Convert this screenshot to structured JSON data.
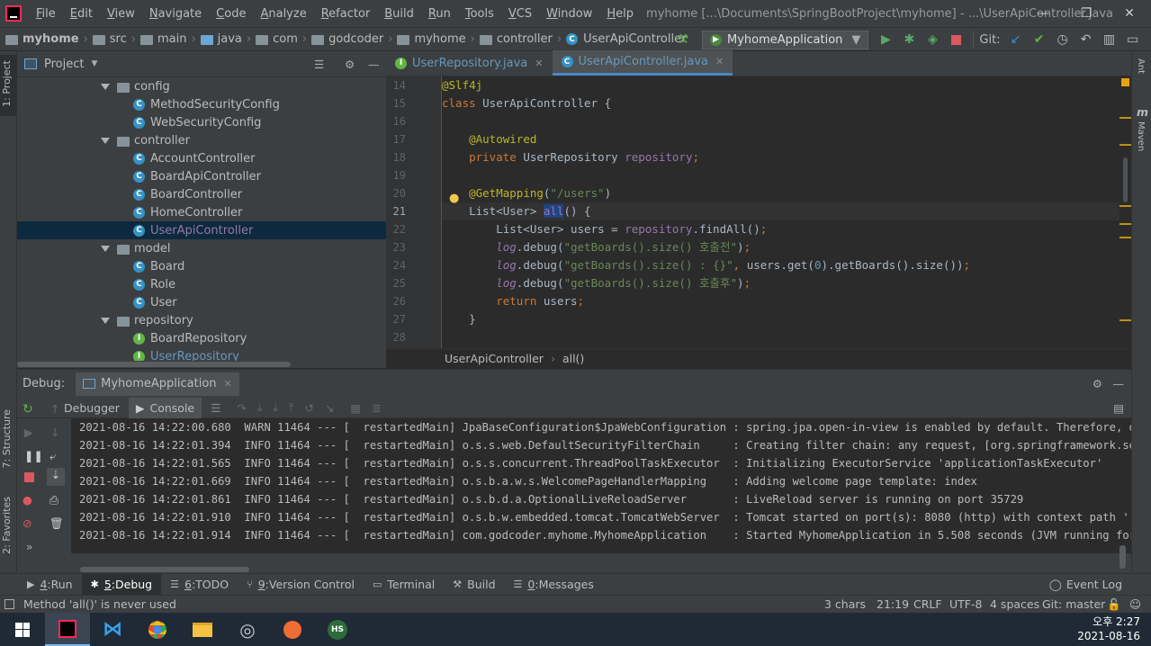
{
  "window": {
    "title": "myhome [...\\Documents\\SpringBootProject\\myhome] - ...\\UserApiController.java",
    "menu": [
      "File",
      "Edit",
      "View",
      "Navigate",
      "Code",
      "Analyze",
      "Refactor",
      "Build",
      "Run",
      "Tools",
      "VCS",
      "Window",
      "Help"
    ]
  },
  "breadcrumb": [
    "myhome",
    "src",
    "main",
    "java",
    "com",
    "godcoder",
    "myhome",
    "controller",
    "UserApiController"
  ],
  "toolbar": {
    "run_config": "MyhomeApplication",
    "git_label": "Git:"
  },
  "project_panel": {
    "title": "Project",
    "tree": [
      {
        "label": "config",
        "type": "folder",
        "indent": 0
      },
      {
        "label": "MethodSecurityConfig",
        "type": "class",
        "indent": 1
      },
      {
        "label": "WebSecurityConfig",
        "type": "class",
        "indent": 1
      },
      {
        "label": "controller",
        "type": "folder",
        "indent": 0
      },
      {
        "label": "AccountController",
        "type": "class",
        "indent": 1
      },
      {
        "label": "BoardApiController",
        "type": "class",
        "indent": 1
      },
      {
        "label": "BoardController",
        "type": "class",
        "indent": 1
      },
      {
        "label": "HomeController",
        "type": "class",
        "indent": 1
      },
      {
        "label": "UserApiController",
        "type": "class",
        "indent": 1,
        "selected": true
      },
      {
        "label": "model",
        "type": "folder",
        "indent": 0
      },
      {
        "label": "Board",
        "type": "class",
        "indent": 1
      },
      {
        "label": "Role",
        "type": "class",
        "indent": 1
      },
      {
        "label": "User",
        "type": "class",
        "indent": 1
      },
      {
        "label": "repository",
        "type": "folder",
        "indent": 0
      },
      {
        "label": "BoardRepository",
        "type": "interface",
        "indent": 1
      },
      {
        "label": "UserRepository",
        "type": "interface",
        "indent": 1
      }
    ]
  },
  "editor": {
    "tabs": [
      {
        "label": "UserRepository.java",
        "icon": "interface",
        "active": false
      },
      {
        "label": "UserApiController.java",
        "icon": "class",
        "active": true
      }
    ],
    "line_numbers": [
      "14",
      "15",
      "16",
      "17",
      "18",
      "19",
      "20",
      "21",
      "22",
      "23",
      "24",
      "25",
      "26",
      "27",
      "28"
    ],
    "current_line": "21",
    "code_breadcrumb": [
      "UserApiController",
      "all()"
    ]
  },
  "debug": {
    "label": "Debug:",
    "session": "MyhomeApplication",
    "tabs": [
      "Debugger",
      "Console"
    ],
    "log_lines": [
      "2021-08-16 14:22:00.680  WARN 11464 --- [  restartedMain] JpaBaseConfiguration$JpaWebConfiguration : spring.jpa.open-in-view is enabled by default. Therefore, database queries",
      "2021-08-16 14:22:01.394  INFO 11464 --- [  restartedMain] o.s.s.web.DefaultSecurityFilterChain     : Creating filter chain: any request, [org.springframework.security.web.cont",
      "2021-08-16 14:22:01.565  INFO 11464 --- [  restartedMain] o.s.s.concurrent.ThreadPoolTaskExecutor  : Initializing ExecutorService 'applicationTaskExecutor'",
      "2021-08-16 14:22:01.669  INFO 11464 --- [  restartedMain] o.s.b.a.w.s.WelcomePageHandlerMapping    : Adding welcome page template: index",
      "2021-08-16 14:22:01.861  INFO 11464 --- [  restartedMain] o.s.b.d.a.OptionalLiveReloadServer       : LiveReload server is running on port 35729",
      "2021-08-16 14:22:01.910  INFO 11464 --- [  restartedMain] o.s.b.w.embedded.tomcat.TomcatWebServer  : Tomcat started on port(s): 8080 (http) with context path ''",
      "2021-08-16 14:22:01.914  INFO 11464 --- [  restartedMain] com.godcoder.myhome.MyhomeApplication    : Started MyhomeApplication in 5.508 seconds (JVM running for 6.433)"
    ]
  },
  "bottom_tabs": [
    {
      "num": "4",
      "label": "Run"
    },
    {
      "num": "5",
      "label": "Debug",
      "active": true
    },
    {
      "num": "6",
      "label": "TODO"
    },
    {
      "num": "9",
      "label": "Version Control"
    },
    {
      "num": "",
      "label": "Terminal"
    },
    {
      "num": "",
      "label": "Build"
    },
    {
      "num": "0",
      "label": "Messages"
    }
  ],
  "event_log": "Event Log",
  "status": {
    "message": "Method 'all()' is never used",
    "chars": "3 chars",
    "position": "21:19",
    "line_sep": "CRLF",
    "encoding": "UTF-8",
    "indent": "4 spaces",
    "git": "Git: master"
  },
  "side_tabs": {
    "left_top": "1: Project",
    "left_structure": "7: Structure",
    "left_favorites": "2: Favorites",
    "right_ant": "Ant",
    "right_maven": "Maven"
  },
  "taskbar": {
    "time": "오후 2:27",
    "date": "2021-08-16"
  }
}
